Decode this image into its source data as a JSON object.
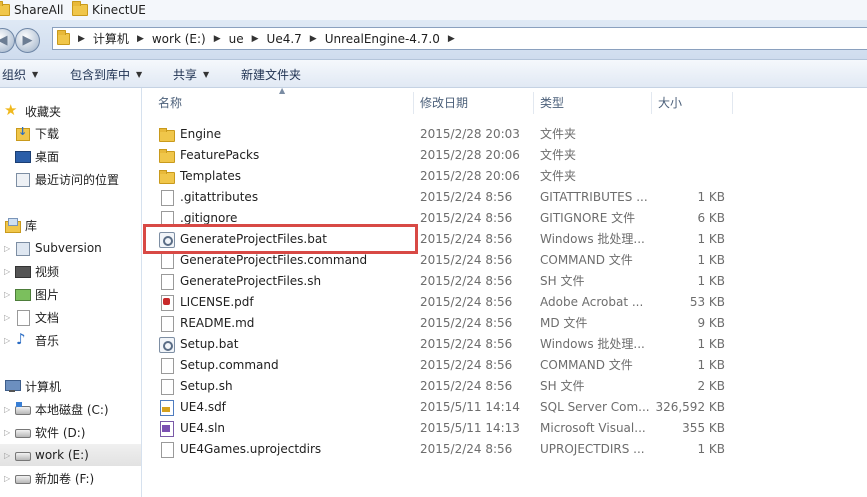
{
  "favorites_bar": {
    "items": [
      {
        "label": "ShareAll",
        "icon": "folder-icon"
      },
      {
        "label": "KinectUE",
        "icon": "folder-icon"
      }
    ]
  },
  "nav": {
    "back_icon": "back-arrow-icon",
    "forward_icon": "forward-arrow-icon"
  },
  "address_bar": {
    "segments": [
      "计算机",
      "work (E:)",
      "ue",
      "Ue4.7",
      "UnrealEngine-4.7.0"
    ]
  },
  "toolbar": {
    "organize_label": "组织",
    "include_library_label": "包含到库中",
    "share_label": "共享",
    "new_folder_label": "新建文件夹"
  },
  "sidebar": {
    "favorites_label": "收藏夹",
    "favorites": [
      "下载",
      "桌面",
      "最近访问的位置"
    ],
    "libraries_label": "库",
    "libraries": [
      "Subversion",
      "视频",
      "图片",
      "文档",
      "音乐"
    ],
    "computer_label": "计算机",
    "drives": [
      "本地磁盘 (C:)",
      "软件 (D:)",
      "work (E:)",
      "新加卷 (F:)"
    ],
    "selected_drive": "work (E:)"
  },
  "columns": {
    "name": "名称",
    "date": "修改日期",
    "type": "类型",
    "size": "大小"
  },
  "files": [
    {
      "name": "Engine",
      "date": "2015/2/28 20:03",
      "type": "文件夹",
      "size": "",
      "icon": "folder-icon"
    },
    {
      "name": "FeaturePacks",
      "date": "2015/2/28 20:06",
      "type": "文件夹",
      "size": "",
      "icon": "folder-icon"
    },
    {
      "name": "Templates",
      "date": "2015/2/28 20:06",
      "type": "文件夹",
      "size": "",
      "icon": "folder-icon"
    },
    {
      "name": ".gitattributes",
      "date": "2015/2/24 8:56",
      "type": "GITATTRIBUTES ...",
      "size": "1 KB",
      "icon": "document-icon"
    },
    {
      "name": ".gitignore",
      "date": "2015/2/24 8:56",
      "type": "GITIGNORE 文件",
      "size": "6 KB",
      "icon": "document-icon"
    },
    {
      "name": "GenerateProjectFiles.bat",
      "date": "2015/2/24 8:56",
      "type": "Windows 批处理...",
      "size": "1 KB",
      "icon": "batch-file-icon"
    },
    {
      "name": "GenerateProjectFiles.command",
      "date": "2015/2/24 8:56",
      "type": "COMMAND 文件",
      "size": "1 KB",
      "icon": "document-icon"
    },
    {
      "name": "GenerateProjectFiles.sh",
      "date": "2015/2/24 8:56",
      "type": "SH 文件",
      "size": "1 KB",
      "icon": "document-icon"
    },
    {
      "name": "LICENSE.pdf",
      "date": "2015/2/24 8:56",
      "type": "Adobe Acrobat ...",
      "size": "53 KB",
      "icon": "pdf-icon"
    },
    {
      "name": "README.md",
      "date": "2015/2/24 8:56",
      "type": "MD 文件",
      "size": "9 KB",
      "icon": "document-icon"
    },
    {
      "name": "Setup.bat",
      "date": "2015/2/24 8:56",
      "type": "Windows 批处理...",
      "size": "1 KB",
      "icon": "batch-file-icon"
    },
    {
      "name": "Setup.command",
      "date": "2015/2/24 8:56",
      "type": "COMMAND 文件",
      "size": "1 KB",
      "icon": "document-icon"
    },
    {
      "name": "Setup.sh",
      "date": "2015/2/24 8:56",
      "type": "SH 文件",
      "size": "2 KB",
      "icon": "document-icon"
    },
    {
      "name": "UE4.sdf",
      "date": "2015/5/11 14:14",
      "type": "SQL Server Com...",
      "size": "326,592 KB",
      "icon": "sql-database-icon"
    },
    {
      "name": "UE4.sln",
      "date": "2015/5/11 14:13",
      "type": "Microsoft Visual...",
      "size": "355 KB",
      "icon": "visual-studio-solution-icon"
    },
    {
      "name": "UE4Games.uprojectdirs",
      "date": "2015/2/24 8:56",
      "type": "UPROJECTDIRS ...",
      "size": "1 KB",
      "icon": "document-icon"
    }
  ],
  "highlighted_file": "GenerateProjectFiles.bat",
  "colors": {
    "highlight_border": "#d84945",
    "folder": "#f0c64a",
    "toolbar_bg": "#e1e9f4"
  }
}
